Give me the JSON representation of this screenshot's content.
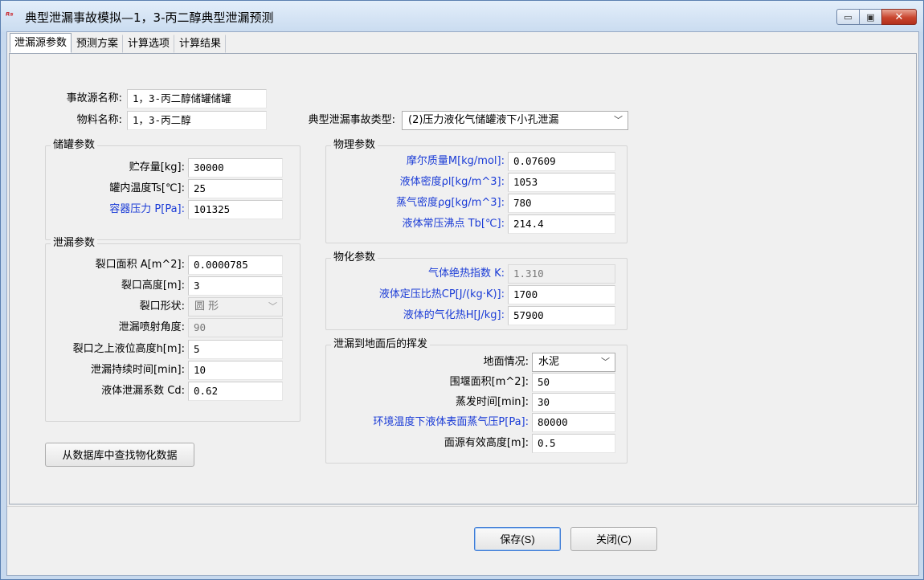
{
  "window": {
    "title": "典型泄漏事故模拟—1，3-丙二醇典型泄漏预测",
    "minimize": "▭",
    "maximize": "▣",
    "close": "✕"
  },
  "tabs": [
    {
      "label": "泄漏源参数",
      "active": true
    },
    {
      "label": "预测方案",
      "active": false
    },
    {
      "label": "计算选项",
      "active": false
    },
    {
      "label": "计算结果",
      "active": false
    }
  ],
  "source": {
    "name_label": "事故源名称:",
    "name_value": "1，3-丙二醇储罐储罐",
    "material_label": "物料名称:",
    "material_value": "1，3-丙二醇",
    "accident_type_label": "典型泄漏事故类型:",
    "accident_type_value": "(2)压力液化气储罐液下小孔泄漏"
  },
  "tank": {
    "title": "储罐参数",
    "storage_label": "贮存量[kg]:",
    "storage_value": "30000",
    "temp_label": "罐内温度Ts[℃]:",
    "temp_value": "25",
    "pressure_label": "容器压力 P[Pa]:",
    "pressure_value": "101325"
  },
  "leak": {
    "title": "泄漏参数",
    "area_label": "裂口面积 A[m^2]:",
    "area_value": "0.0000785",
    "height_label": "裂口高度[m]:",
    "height_value": "3",
    "shape_label": "裂口形状:",
    "shape_value": "圆  形",
    "angle_label": "泄漏喷射角度:",
    "angle_value": "90",
    "level_label": "裂口之上液位高度h[m]:",
    "level_value": "5",
    "duration_label": "泄漏持续时间[min]:",
    "duration_value": "10",
    "coef_label": "液体泄漏系数  Cd:",
    "coef_value": "0.62"
  },
  "lookup_button": "从数据库中查找物化数据",
  "physical": {
    "title": "物理参数",
    "molar_label": "摩尔质量M[kg/mol]:",
    "molar_value": "0.07609",
    "liquid_density_label": "液体密度ρl[kg/m^3]:",
    "liquid_density_value": "1053",
    "vapor_density_label": "蒸气密度ρg[kg/m^3]:",
    "vapor_density_value": "780",
    "boiling_label": "液体常压沸点 Tb[℃]:",
    "boiling_value": "214.4"
  },
  "chemical": {
    "title": "物化参数",
    "adiabatic_label": "气体绝热指数  K:",
    "adiabatic_value": "1.310",
    "cp_label": "液体定压比热CP[J/(kg·K)]:",
    "cp_value": "1700",
    "vaporization_label": "液体的气化热H[J/kg]:",
    "vaporization_value": "57900"
  },
  "evaporation": {
    "title": "泄漏到地面后的挥发",
    "ground_label": "地面情况:",
    "ground_value": "水泥",
    "dike_label": "围堰面积[m^2]:",
    "dike_value": "50",
    "evap_time_label": "蒸发时间[min]:",
    "evap_time_value": "30",
    "vapor_pressure_label": "环境温度下液体表面蒸气压P[Pa]:",
    "vapor_pressure_value": "80000",
    "source_height_label": "面源有效高度[m]:",
    "source_height_value": "0.5"
  },
  "footer": {
    "save": "保存(S)",
    "close": "关闭(C)"
  },
  "icons": {
    "dropdown": "chevron-down-icon",
    "app": "app-icon"
  },
  "colors": {
    "accent_label": "#1a3bd6",
    "close_button": "#c9452e"
  }
}
